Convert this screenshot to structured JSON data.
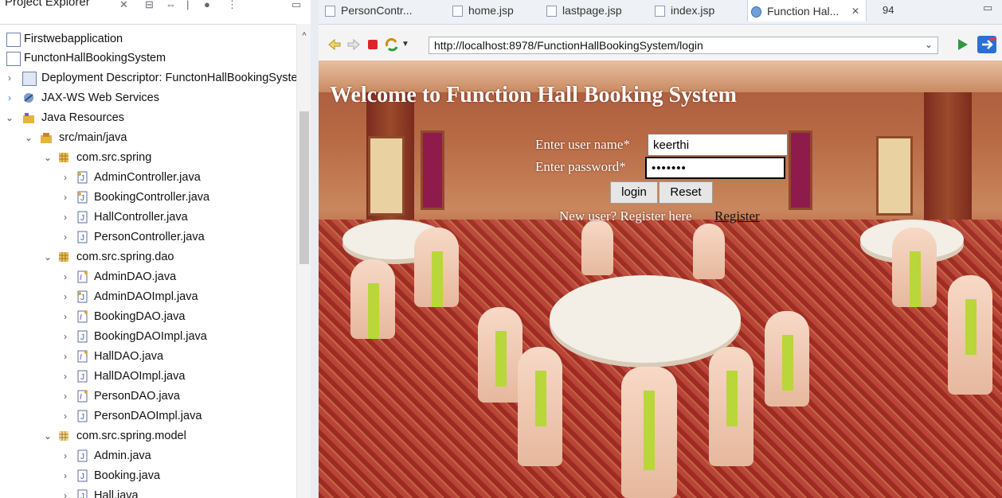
{
  "explorer": {
    "title": "Project Explorer",
    "tree": [
      {
        "label": "Firstwebapplication",
        "icon": "project-icon",
        "expanded": null
      },
      {
        "label": "FunctonHallBookingSystem",
        "icon": "project-icon",
        "expanded": null
      },
      {
        "label": "Deployment Descriptor: FunctonHallBookingSyste",
        "icon": "deployment-descriptor-icon",
        "expanded": false
      },
      {
        "label": "JAX-WS Web Services",
        "icon": "web-services-icon",
        "expanded": false
      },
      {
        "label": "Java Resources",
        "icon": "java-resources-icon",
        "expanded": true
      },
      {
        "label": "src/main/java",
        "icon": "source-folder-icon",
        "expanded": true
      },
      {
        "label": "com.src.spring",
        "icon": "package-icon",
        "expanded": true
      },
      {
        "label": "AdminController.java",
        "icon": "java-file-icon",
        "expanded": false
      },
      {
        "label": "BookingController.java",
        "icon": "java-file-icon",
        "expanded": false
      },
      {
        "label": "HallController.java",
        "icon": "java-file-icon",
        "expanded": false
      },
      {
        "label": "PersonController.java",
        "icon": "java-file-icon",
        "expanded": false
      },
      {
        "label": "com.src.spring.dao",
        "icon": "package-icon",
        "expanded": true
      },
      {
        "label": "AdminDAO.java",
        "icon": "java-interface-icon",
        "expanded": false
      },
      {
        "label": "AdminDAOImpl.java",
        "icon": "java-file-icon",
        "expanded": false
      },
      {
        "label": "BookingDAO.java",
        "icon": "java-interface-icon",
        "expanded": false
      },
      {
        "label": "BookingDAOImpl.java",
        "icon": "java-file-icon",
        "expanded": false
      },
      {
        "label": "HallDAO.java",
        "icon": "java-interface-icon",
        "expanded": false
      },
      {
        "label": "HallDAOImpl.java",
        "icon": "java-file-icon",
        "expanded": false
      },
      {
        "label": "PersonDAO.java",
        "icon": "java-interface-icon",
        "expanded": false
      },
      {
        "label": "PersonDAOImpl.java",
        "icon": "java-file-icon",
        "expanded": false
      },
      {
        "label": "com.src.spring.model",
        "icon": "package-icon",
        "expanded": true
      },
      {
        "label": "Admin.java",
        "icon": "java-file-icon",
        "expanded": false
      },
      {
        "label": "Booking.java",
        "icon": "java-file-icon",
        "expanded": false
      },
      {
        "label": "Hall.java",
        "icon": "java-file-icon",
        "expanded": false
      }
    ]
  },
  "browser": {
    "tabs": [
      {
        "label": "PersonContr..."
      },
      {
        "label": "home.jsp"
      },
      {
        "label": "lastpage.jsp"
      },
      {
        "label": "index.jsp"
      },
      {
        "label": "Function Hal..."
      },
      {
        "label": "94"
      }
    ],
    "url": "http://localhost:8978/FunctionHallBookingSystem/login"
  },
  "page": {
    "heading": "Welcome to Function Hall Booking System",
    "username_label": "Enter user name*",
    "username_value": "keerthi",
    "password_label": "Enter password*",
    "password_value": "•••••••",
    "login_button": "login",
    "reset_button": "Reset",
    "register_prompt": "New user? Register here",
    "register_link": "Register"
  },
  "colors": {
    "package": "#c98a1a",
    "java_file": "#3b5bb5",
    "accent_green": "#2f9a3c"
  }
}
